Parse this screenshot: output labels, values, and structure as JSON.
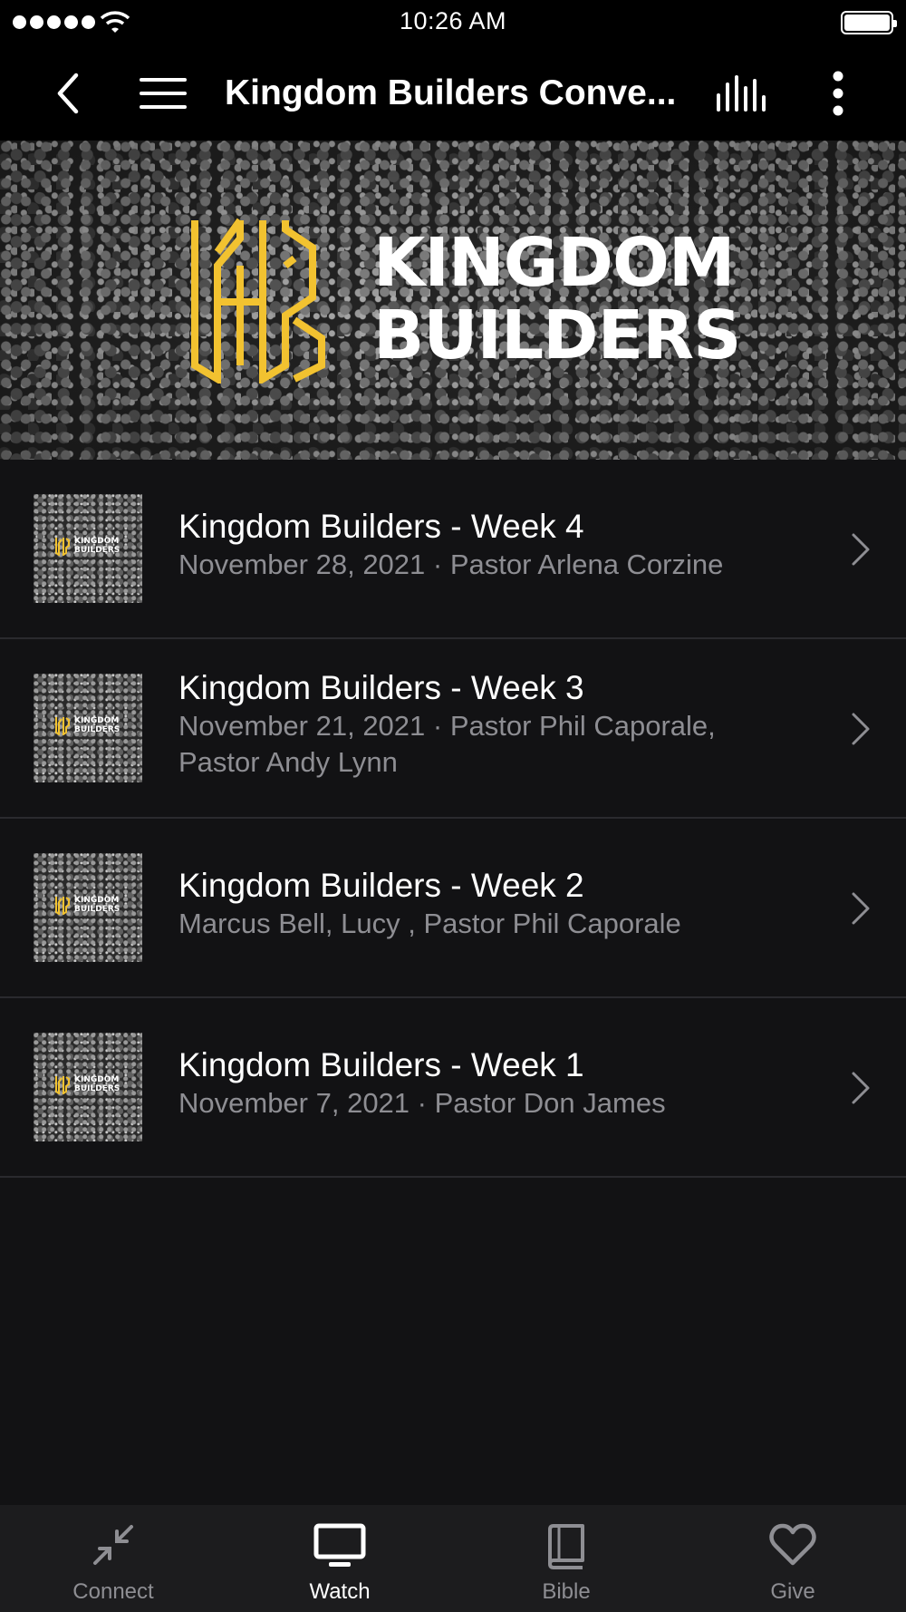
{
  "status_bar": {
    "time": "10:26 AM"
  },
  "nav": {
    "title": "Kingdom Builders Conve...",
    "back_icon": "chevron-left-icon",
    "menu_icon": "hamburger-icon",
    "audio_icon": "audio-bars-icon",
    "more_icon": "vertical-ellipsis-icon"
  },
  "hero": {
    "line1": "KINGDOM",
    "line2": "BUILDERS",
    "accent": "#f2c230"
  },
  "episodes": [
    {
      "title": "Kingdom Builders - Week 4",
      "subtitle_line1": "November 28, 2021 · Pastor Arlena Corzine",
      "subtitle_line2": ""
    },
    {
      "title": "Kingdom Builders - Week 3",
      "subtitle_line1": "November 21, 2021 · Pastor Phil Caporale,",
      "subtitle_line2": "Pastor Andy Lynn"
    },
    {
      "title": "Kingdom Builders - Week 2",
      "subtitle_line1": "Marcus Bell, Lucy , Pastor Phil Caporale",
      "subtitle_line2": ""
    },
    {
      "title": "Kingdom Builders - Week 1",
      "subtitle_line1": "November 7, 2021 · Pastor Don James",
      "subtitle_line2": ""
    }
  ],
  "thumb_text": {
    "line1": "KINGDOM",
    "line2": "BUILDERS"
  },
  "tabs": [
    {
      "label": "Connect",
      "icon": "arrows-collapse-icon",
      "active": false
    },
    {
      "label": "Watch",
      "icon": "tv-icon",
      "active": true
    },
    {
      "label": "Bible",
      "icon": "book-icon",
      "active": false
    },
    {
      "label": "Give",
      "icon": "heart-icon",
      "active": false
    }
  ],
  "colors": {
    "background": "#121214",
    "nav": "#000000",
    "tab_bar": "#1c1c1e",
    "secondary_text": "#8e8e93",
    "accent": "#f2c230"
  }
}
